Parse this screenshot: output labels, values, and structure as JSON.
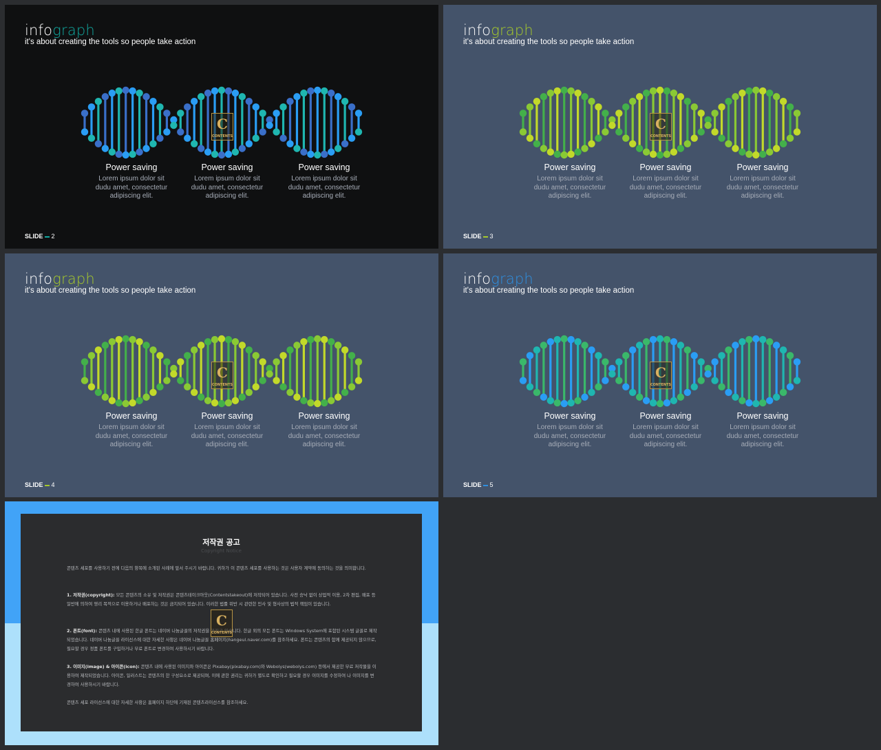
{
  "slides": [
    {
      "title_a": "info",
      "title_b": "graph",
      "subtitle": "it's about creating the tools so people take action",
      "slide_label": "SLIDE",
      "slide_number": "2",
      "background": "#0f1011",
      "accent": "#11a9a0",
      "palette": [
        "#2a9df4",
        "#1fb6b0",
        "#3a6fc9"
      ],
      "items": [
        {
          "heading": "Power saving",
          "body": "Lorem ipsum dolor sit\ndudu amet, consectetur\nadipiscing elit."
        },
        {
          "heading": "Power saving",
          "body": "Lorem ipsum dolor sit\ndudu amet, consectetur\nadipiscing elit."
        },
        {
          "heading": "Power saving",
          "body": "Lorem ipsum dolor sit\ndudu amet, consectetur\nadipiscing elit."
        }
      ]
    },
    {
      "title_a": "info",
      "title_b": "graph",
      "subtitle": "it's about creating the tools so people take action",
      "slide_label": "SLIDE",
      "slide_number": "3",
      "background": "#44536a",
      "accent": "#a6c92c",
      "palette": [
        "#8ac934",
        "#c2d92a",
        "#43b04a"
      ],
      "items": [
        {
          "heading": "Power saving",
          "body": "Lorem ipsum dolor sit\ndudu amet, consectetur\nadipiscing elit."
        },
        {
          "heading": "Power saving",
          "body": "Lorem ipsum dolor sit\ndudu amet, consectetur\nadipiscing elit."
        },
        {
          "heading": "Power saving",
          "body": "Lorem ipsum dolor sit\ndudu amet, consectetur\nadipiscing elit."
        }
      ]
    },
    {
      "title_a": "info",
      "title_b": "graph",
      "subtitle": "it's about creating the tools so people take action",
      "slide_label": "SLIDE",
      "slide_number": "4",
      "background": "#44536a",
      "accent": "#a6c92c",
      "palette": [
        "#8ac934",
        "#c2d92a",
        "#43b04a"
      ],
      "items": [
        {
          "heading": "Power saving",
          "body": "Lorem ipsum dolor sit\ndudu amet, consectetur\nadipiscing elit."
        },
        {
          "heading": "Power saving",
          "body": "Lorem ipsum dolor sit\ndudu amet, consectetur\nadipiscing elit."
        },
        {
          "heading": "Power saving",
          "body": "Lorem ipsum dolor sit\ndudu amet, consectetur\nadipiscing elit."
        }
      ]
    },
    {
      "title_a": "info",
      "title_b": "graph",
      "subtitle": "it's about creating the tools so people take action",
      "slide_label": "SLIDE",
      "slide_number": "5",
      "background": "#44536a",
      "accent": "#2f8fe0",
      "palette": [
        "#2a9df4",
        "#1fb6b0",
        "#3ab86a"
      ],
      "items": [
        {
          "heading": "Power saving",
          "body": "Lorem ipsum dolor sit\ndudu amet, consectetur\nadipiscing elit."
        },
        {
          "heading": "Power saving",
          "body": "Lorem ipsum dolor sit\ndudu amet, consectetur\nadipiscing elit."
        },
        {
          "heading": "Power saving",
          "body": "Lorem ipsum dolor sit\ndudu amet, consectetur\nadipiscing elit."
        }
      ]
    }
  ],
  "logo": {
    "letter": "C",
    "caption": "CONTENTS"
  },
  "notice": {
    "title": "저작권 공고",
    "subtitle": "Copyright Notice",
    "p1": "콘텐츠 세포를 사용하기 전에 다음의 항목에 소개된 사례에 앞서 주시기 바랍니다. 귀하가 이 콘텐츠 세포를 사용하는 것은 사용자 계약에 동의하는 것을 의미합니다.",
    "p2_head": "1. 저작권(copyright):",
    "p2_body": " 모든 콘텐츠의 소유 및 저작권은 콘텐츠테이크아웃(Contentstakeout)에 저작되어 있습니다. 사전 승낙 없이 상업적 이용, 2차 편집, 배포 등 일반에 의하여 영리 목적으로 이용하거나 배포하는 것은 금지되어 있습니다. 이러한 법률 위반 시 관련한 민사 및 형사상의 법적 책임이 있습니다.",
    "p3_head": "2. 폰트(font):",
    "p3_body": " 콘텐츠 내에 사용된 한글 폰트는 네이버 나눔글꼴의 저작권을 가지고 있습니다. 한글 외의 모든 폰트는 Windows System에 포함된 시스템 글꼴로 제작되었습니다. 네이버 나눔글꼴 라이선스에 대한 자세한 사항은 네이버 나눔글꼴 홈페이지(hangeul.naver.com)를 참조하세요. 폰트는 콘텐츠의 함께 제공되지 않으므로, 필요할 경우 정품 폰트를 구입하거나 무료 폰트로 변경하여 사용하시기 바랍니다.",
    "p4_head": "3. 이미지(image) & 아이콘(icon):",
    "p4_body": " 콘텐츠 내에 사용된 이미지와 아이콘은 Pixabay(pixabay.com)와 Webolys(webolys.com) 등에서 제공한 무료 저작물을 이용하여 제작되었습니다. 아이콘, 일러스트는 콘텐츠의 한 구성요소로 제공되며, 이에 관한 권리는 귀하가 별도로 확인하고 필요할 경우 이미지를 수정하여 나 이미지를 변경하여 사용하시기 바랍니다.",
    "p5": "콘텐츠 세포 라이선스에 대한 자세한 사항은 홈페이지 하단에 기재된 콘텐츠라이선스를 참조하세요."
  }
}
